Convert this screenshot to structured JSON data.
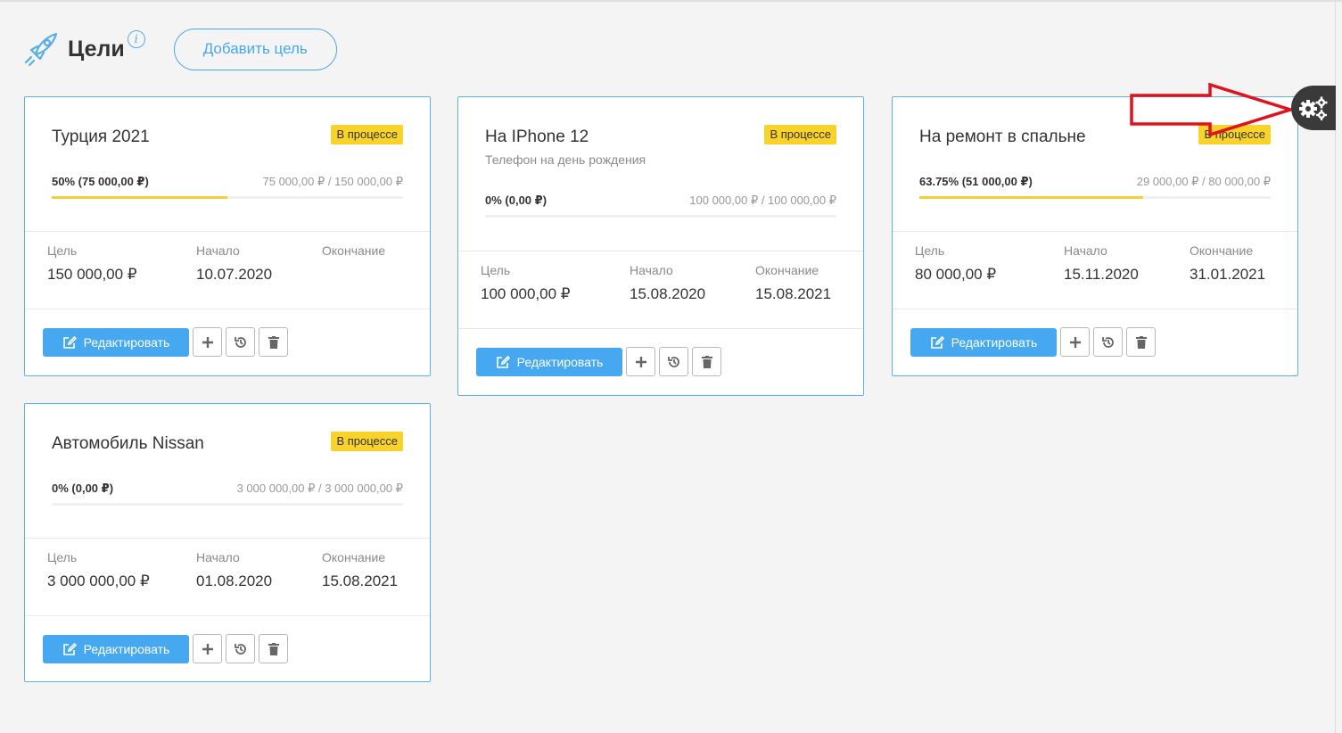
{
  "header": {
    "title": "Цели",
    "info_symbol": "i",
    "add_button": "Добавить цель"
  },
  "labels": {
    "goal": "Цель",
    "start": "Начало",
    "end": "Окончание",
    "edit": "Редактировать"
  },
  "goals": [
    {
      "title": "Турция 2021",
      "subtitle": "",
      "status": "В процессе",
      "progress_text": "50% (75 000,00 ₽)",
      "progress_fraction": 0.5,
      "amounts": "75 000,00 ₽ / 150 000,00 ₽",
      "goal": "150 000,00 ₽",
      "start": "10.07.2020",
      "end": ""
    },
    {
      "title": "На IPhone 12",
      "subtitle": "Телефон на день рождения",
      "status": "В процессе",
      "progress_text": "0% (0,00 ₽)",
      "progress_fraction": 0,
      "amounts": "100 000,00 ₽ / 100 000,00 ₽",
      "goal": "100 000,00 ₽",
      "start": "15.08.2020",
      "end": "15.08.2021"
    },
    {
      "title": "На ремонт в спальне",
      "subtitle": "",
      "status": "В процессе",
      "progress_text": "63.75% (51 000,00 ₽)",
      "progress_fraction": 0.6375,
      "amounts": "29 000,00 ₽ / 80 000,00 ₽",
      "goal": "80 000,00 ₽",
      "start": "15.11.2020",
      "end": "31.01.2021"
    },
    {
      "title": "Автомобиль Nissan",
      "subtitle": "",
      "status": "В процессе",
      "progress_text": "0% (0,00 ₽)",
      "progress_fraction": 0,
      "amounts": "3 000 000,00 ₽ / 3 000 000,00 ₽",
      "goal": "3 000 000,00 ₽",
      "start": "01.08.2020",
      "end": "15.08.2021"
    }
  ],
  "colors": {
    "accent": "#46a8f0",
    "badge": "#f9d22a",
    "progress": "#f5cf3a",
    "arrow": "#e0131c",
    "settings_tab": "#3a3a3a"
  },
  "icons": {
    "header": "rocket-icon",
    "info": "info-icon",
    "edit": "edit-icon",
    "add": "plus-icon",
    "history": "history-icon",
    "delete": "trash-icon",
    "settings": "gears-icon",
    "annotation": "red-arrow-icon"
  }
}
